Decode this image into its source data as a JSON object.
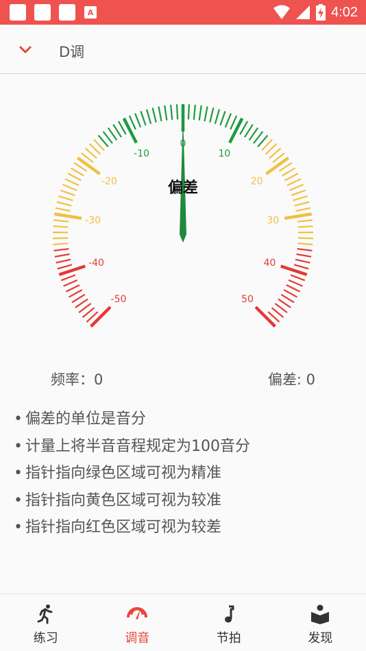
{
  "status_bar": {
    "time": "4:02",
    "icons": [
      "app-icon",
      "app-icon",
      "app-icon",
      "notification-icon",
      "wifi-icon",
      "signal-icon",
      "battery-charging-icon"
    ]
  },
  "header": {
    "title": "D调",
    "collapse_icon": "chevron-down-icon"
  },
  "gauge": {
    "label": "偏差",
    "deviation_value": 0,
    "range": [
      -50,
      50
    ],
    "tick_labels": [
      "-50",
      "-40",
      "-30",
      "-20",
      "-10",
      "0",
      "10",
      "20",
      "30",
      "40",
      "50"
    ],
    "zones": {
      "green": {
        "range": [
          -15,
          15
        ],
        "color": "#1e9a40"
      },
      "yellow": {
        "range": [
          15,
          35
        ],
        "color": "#f0c040"
      },
      "red": {
        "range": [
          35,
          50
        ],
        "color": "#e53935"
      }
    }
  },
  "readouts": {
    "frequency": "频率：0",
    "deviation": "偏差: 0"
  },
  "notes": {
    "bullet": "•",
    "items": [
      "偏差的单位是音分",
      "计量上将半音音程规定为100音分",
      "指针指向绿色区域可视为精准",
      "指针指向黄色区域可视为较准",
      "指针指向红色区域可视为较差"
    ]
  },
  "bottom_nav": {
    "items": [
      {
        "label": "练习",
        "icon": "running-person-icon",
        "active": false
      },
      {
        "label": "调音",
        "icon": "tuner-gauge-icon",
        "active": true
      },
      {
        "label": "节拍",
        "icon": "music-note-icon",
        "active": false
      },
      {
        "label": "发现",
        "icon": "reading-book-icon",
        "active": false
      }
    ],
    "active_color": "#e8453c"
  }
}
